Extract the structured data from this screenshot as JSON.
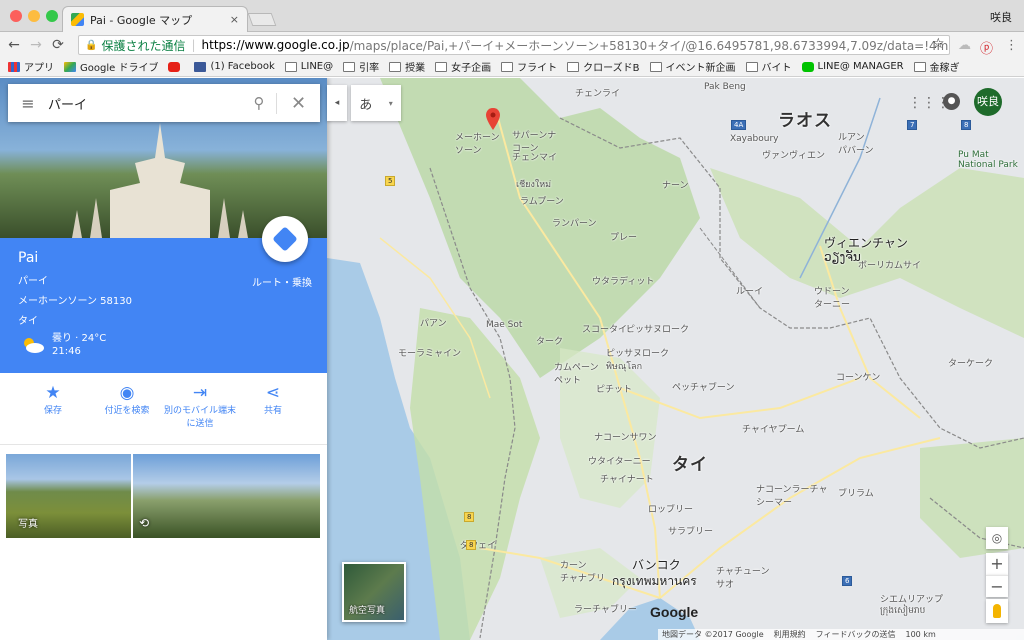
{
  "browser": {
    "tab_title": "Pai - Google マップ",
    "tab_close": "×",
    "user_name": "咲良",
    "nav": {
      "back": "←",
      "forward": "→",
      "reload": "⟳"
    },
    "address": {
      "lock": "🔒",
      "secure_label": "保護された通信",
      "separator": "|",
      "host": "https://www.google.co.jp",
      "path": "/maps/place/Pai,+パーイ+メーホーンソーン+58130+タイ/@16.6495781,98.6733994,7.09z/data=!4m5!3m4!1s0x30..."
    },
    "star": "☆",
    "menu": "⋮",
    "bookmarks": [
      {
        "label": "アプリ",
        "icon": "apps-grid-icon"
      },
      {
        "label": "Google ドライブ",
        "icon": "google-drive-icon"
      },
      {
        "label": "",
        "icon": "youtube-icon"
      },
      {
        "label": "(1) Facebook",
        "icon": "facebook-icon"
      },
      {
        "label": "LINE@",
        "icon": "folder-icon"
      },
      {
        "label": "引率",
        "icon": "folder-icon"
      },
      {
        "label": "授業",
        "icon": "folder-icon"
      },
      {
        "label": "女子企画",
        "icon": "folder-icon"
      },
      {
        "label": "フライト",
        "icon": "folder-icon"
      },
      {
        "label": "クローズドB",
        "icon": "folder-icon"
      },
      {
        "label": "イベント新企画",
        "icon": "folder-icon"
      },
      {
        "label": "バイト",
        "icon": "folder-icon"
      },
      {
        "label": "LINE@ MANAGER",
        "icon": "line-icon"
      },
      {
        "label": "金稼ぎ",
        "icon": "folder-icon"
      }
    ]
  },
  "search": {
    "menu": "≡",
    "query": "パーイ",
    "search_icon": "⚲",
    "clear": "✕"
  },
  "place": {
    "name": "Pai",
    "line1": "パーイ",
    "line2": "メーホーンソーン 58130",
    "line3": "タイ",
    "weather": "曇り · 24°C",
    "time": "21:46",
    "route_label": "ルート・乗換"
  },
  "actions": [
    {
      "icon": "★",
      "label": "保存"
    },
    {
      "icon": "◉",
      "label": "付近を検索"
    },
    {
      "icon": "⇥",
      "label": "別のモバイル端末に送信"
    },
    {
      "icon": "⋖",
      "label": "共有"
    }
  ],
  "photos": {
    "photo_label": "写真",
    "photo360": "⟲"
  },
  "ime": {
    "char": "あ",
    "caret": "▾",
    "collapse": "◂"
  },
  "apps": "⋮⋮⋮",
  "user_avatar": "咲良",
  "satellite_label": "航空写真",
  "controls": {
    "locate": "◎",
    "zoom_in": "+",
    "zoom_out": "−"
  },
  "google_logo": "Google",
  "footer": {
    "data": "地図データ ©2017 Google",
    "terms": "利用規約",
    "feedback": "フィードバックの送信",
    "scale": "100 km"
  },
  "map_labels": {
    "laos": "ラオス",
    "thai": "タイ",
    "vientiane": "ヴィエンチャン",
    "vientiane_lao": "ວຽງຈັນ",
    "bangkok": "バンコク",
    "bangkok_thai": "กรุงเทพมหานคร",
    "pak_beng": "Pak Beng",
    "xayabury": "Xayaboury",
    "chiang_rai": "チェンライ",
    "mae_hong_son": "メーホーン\nソーン",
    "sanpatong": "サパーンナ\nコーン",
    "chiang_mai": "チェンマイ",
    "chiang_mai_thai": "เชียงใหม่",
    "lampang": "ランパーン",
    "lamphun": "ラムプーン",
    "nan": "ナーン",
    "phrae": "プレー",
    "uttaradit": "ウタラディット",
    "sukhothai": "スコータイ",
    "phitsanulok": "ピッサヌローク",
    "phitsanulok2": "ピッサヌローク\nพิษณุโลก",
    "phichit": "ピチット",
    "phetchabun": "ペッチャブーン",
    "kamphaeng": "カムペーン\nペット",
    "mae_sot": "Mae Sot",
    "tak": "ターク",
    "pa_an": "パアン",
    "mawlamyine": "モーラミャイン",
    "nakhon_sawan": "ナコーンサワン",
    "uthai_thani": "ウタイターニー",
    "chai_nat": "チャイナート",
    "lopburi": "ロッブリー",
    "saraburi": "サラブリー",
    "kanchanaburi": "カーン\nチャナブリ",
    "ratchaburi": "ラーチャブリー",
    "loei": "ルーイ",
    "udon": "ウドーン\nターニー",
    "khon_kaen": "コーンケン",
    "chaiyaphum": "チャイヤプーム",
    "nakhon_ratchasima": "ナコーンラーチャ\nシーマー",
    "buriram": "ブリラム",
    "dawei": "ダウェイ",
    "chachoengsao": "チャチューン\nサオ",
    "siem_reap": "シエムリアップ\nក្រុងសៀមរាប",
    "luang_prabang": "ルアン\nパバーン",
    "bolikhamxay": "ボーリカムサイ",
    "pu_mat": "Pu Mat\nNational Park",
    "vang_vieng": "ヴァンヴィエン",
    "thakhek": "ターケーク"
  }
}
